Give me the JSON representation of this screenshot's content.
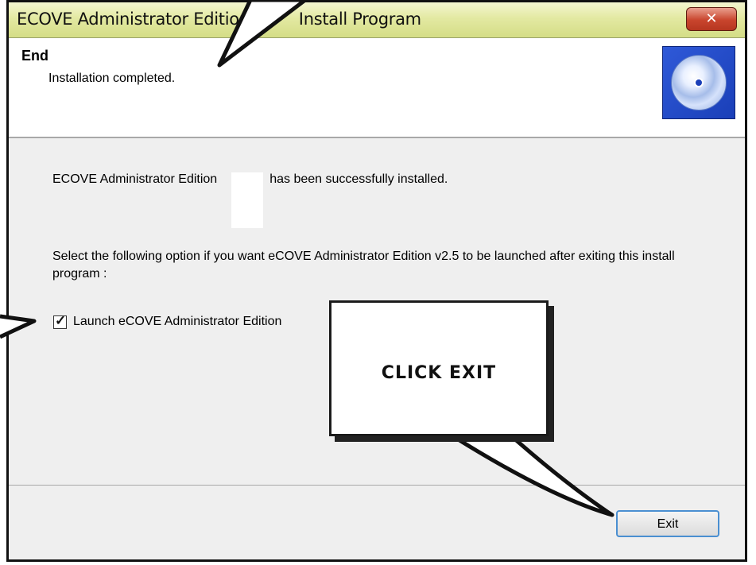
{
  "window": {
    "title_before": "ECOVE Administrator Edition",
    "title_after": "Install Program",
    "close_icon": "close-x-icon"
  },
  "header": {
    "title": "End",
    "subtitle": "Installation completed.",
    "icon": "cd-disc-icon"
  },
  "body": {
    "message_before": "ECOVE Administrator Edition",
    "message_after": "has been successfully installed.",
    "option_prompt": "Select the following option if you want eCOVE Administrator Edition v2.5  to be launched after exiting this install program :",
    "launch_checkbox": {
      "label": "Launch eCOVE Administrator Edition",
      "checked": true
    }
  },
  "footer": {
    "exit_label": "Exit"
  },
  "annotation": {
    "callout_text": "CLICK EXIT"
  }
}
